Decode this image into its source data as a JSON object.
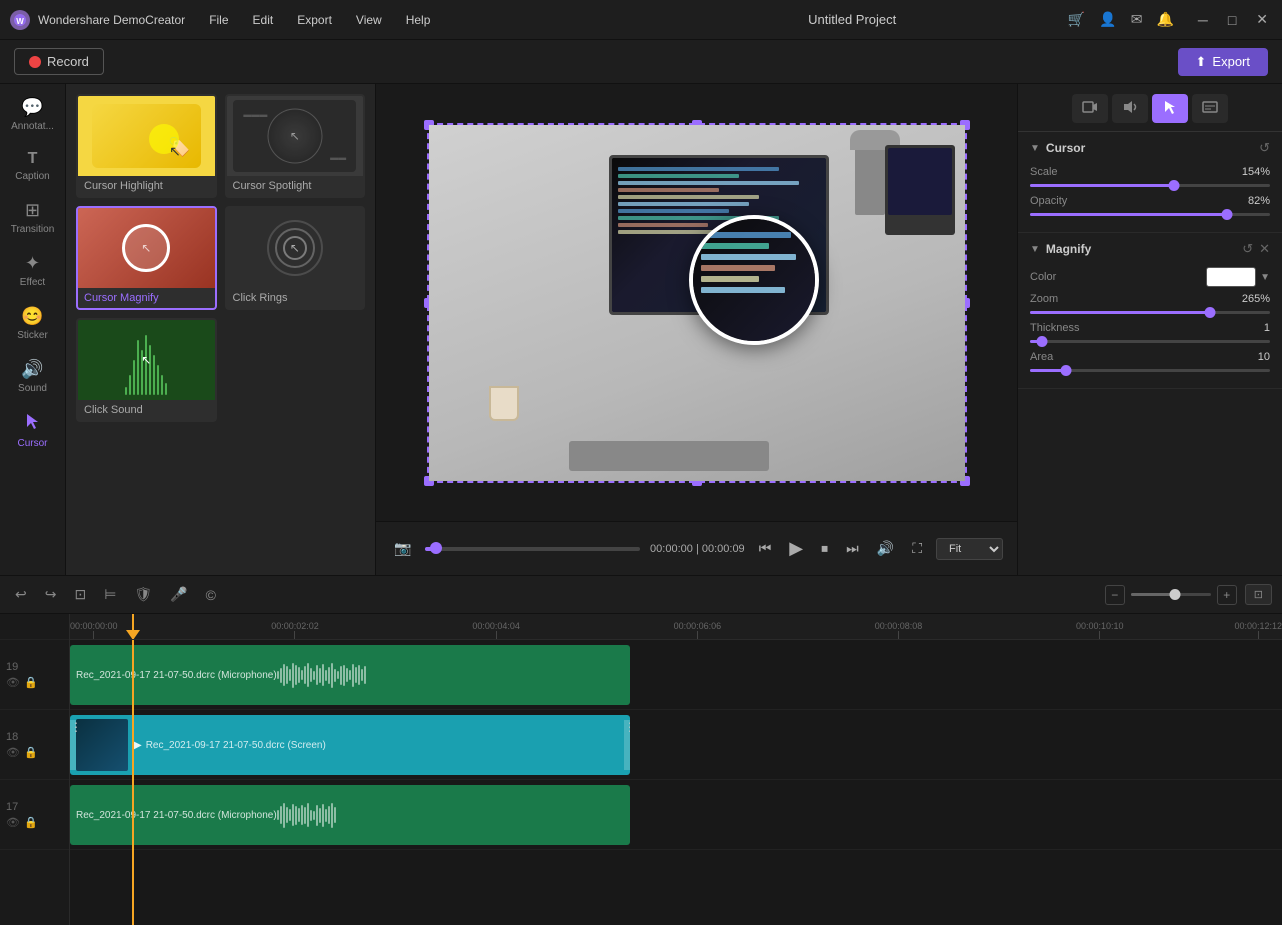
{
  "app": {
    "name": "Wondershare DemoCreator",
    "logo_text": "W",
    "project_title": "Untitled Project"
  },
  "titlebar": {
    "menus": [
      "File",
      "Edit",
      "Export",
      "View",
      "Help"
    ],
    "window_controls": [
      "─",
      "□",
      "✕"
    ]
  },
  "toolbar": {
    "record_label": "Record",
    "export_label": "Export"
  },
  "sidebar": {
    "items": [
      {
        "id": "annotate",
        "icon": "💬",
        "label": "Annotat..."
      },
      {
        "id": "caption",
        "icon": "T",
        "label": "Caption"
      },
      {
        "id": "transition",
        "icon": "⊞",
        "label": "Transition"
      },
      {
        "id": "effect",
        "icon": "✦",
        "label": "Effect"
      },
      {
        "id": "sticker",
        "icon": "😊",
        "label": "Sticker"
      },
      {
        "id": "sound",
        "icon": "🔊",
        "label": "Sound"
      },
      {
        "id": "cursor",
        "icon": "↖",
        "label": "Cursor",
        "active": true
      }
    ]
  },
  "effects_panel": {
    "items": [
      {
        "id": "cursor-highlight",
        "label": "Cursor Highlight",
        "selected": false
      },
      {
        "id": "cursor-spotlight",
        "label": "Cursor Spotlight",
        "selected": false
      },
      {
        "id": "cursor-magnify",
        "label": "Cursor Magnify",
        "selected": true
      },
      {
        "id": "click-rings",
        "label": "Click Rings",
        "selected": false
      },
      {
        "id": "click-sound",
        "label": "Click Sound",
        "selected": false
      }
    ]
  },
  "preview": {
    "time_current": "00:00:00",
    "time_total": "00:00:09",
    "fit_label": "Fit",
    "progress_percent": 5
  },
  "right_panel": {
    "tabs": [
      {
        "id": "video",
        "icon": "🎥"
      },
      {
        "id": "audio",
        "icon": "🔊"
      },
      {
        "id": "cursor",
        "icon": "↖",
        "active": true
      },
      {
        "id": "caption",
        "icon": "≡"
      }
    ],
    "cursor_section": {
      "title": "Cursor",
      "scale_label": "Scale",
      "scale_value": "154%",
      "scale_percent": 60,
      "opacity_label": "Opacity",
      "opacity_value": "82%",
      "opacity_percent": 82
    },
    "magnify_section": {
      "title": "Magnify",
      "color_label": "Color",
      "color_value": "#ffffff",
      "zoom_label": "Zoom",
      "zoom_value": "265%",
      "zoom_percent": 75,
      "thickness_label": "Thickness",
      "thickness_value": "1",
      "thickness_percent": 5,
      "area_label": "Area",
      "area_value": "10",
      "area_percent": 15
    }
  },
  "timeline": {
    "ruler_marks": [
      "00:00:00:00",
      "00:00:02:02",
      "00:00:04:04",
      "00:00:06:06",
      "00:00:08:08",
      "00:00:10:10",
      "00:00:12:12"
    ],
    "tracks": [
      {
        "num": "19",
        "type": "audio",
        "label": "Rec_2021-09-17 21-07-50.dcrc (Microphone)"
      },
      {
        "num": "18",
        "type": "video",
        "label": "Rec_2021-09-17 21-07-50.dcrc (Screen)"
      },
      {
        "num": "17",
        "type": "audio",
        "label": "Rec_2021-09-17 21-07-50.dcrc (Microphone)"
      }
    ]
  }
}
